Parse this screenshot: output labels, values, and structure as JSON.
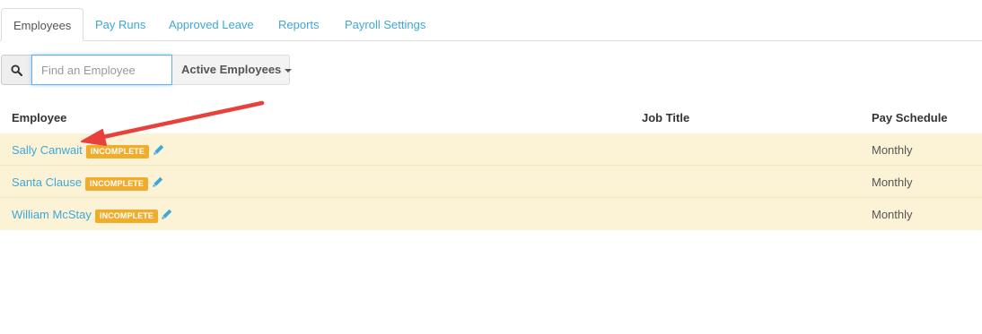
{
  "tabs": [
    {
      "label": "Employees",
      "active": true
    },
    {
      "label": "Pay Runs",
      "active": false
    },
    {
      "label": "Approved Leave",
      "active": false
    },
    {
      "label": "Reports",
      "active": false
    },
    {
      "label": "Payroll Settings",
      "active": false
    }
  ],
  "search": {
    "icon": "search-icon",
    "placeholder": "Find an Employee",
    "value": "",
    "filter_label": "Active Employees"
  },
  "table": {
    "columns": [
      "Employee",
      "Job Title",
      "Pay Schedule"
    ],
    "rows": [
      {
        "name": "Sally Canwait",
        "status": "INCOMPLETE",
        "job_title": "",
        "pay_schedule": "Monthly"
      },
      {
        "name": "Santa Clause",
        "status": "INCOMPLETE",
        "job_title": "",
        "pay_schedule": "Monthly"
      },
      {
        "name": "William McStay",
        "status": "INCOMPLETE",
        "job_title": "",
        "pay_schedule": "Monthly"
      }
    ]
  },
  "colors": {
    "link": "#3fa7d8",
    "badge": "#f0ad2c",
    "row_highlight": "#fcf3d6",
    "annotation_arrow": "#e8413b"
  },
  "icons": {
    "edit": "pencil-icon",
    "annotation": "red-arrow-annotation"
  }
}
